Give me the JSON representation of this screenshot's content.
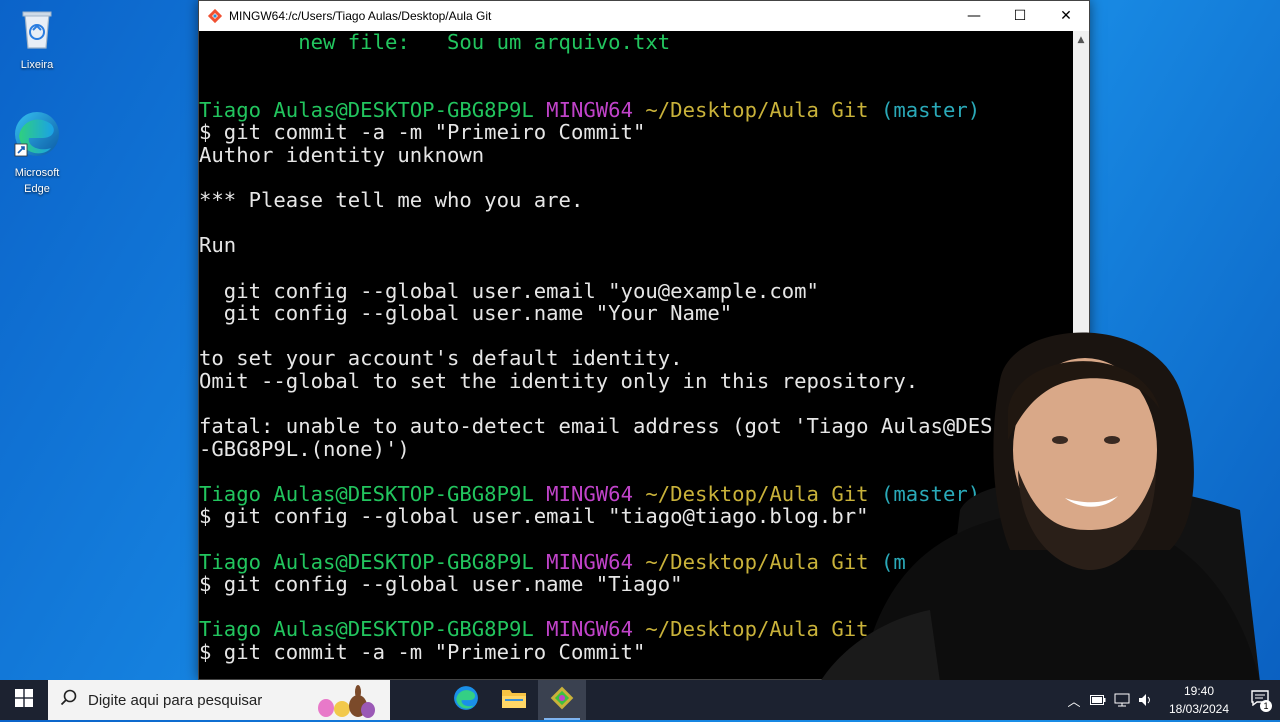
{
  "desktop": {
    "icons": [
      {
        "label": "Lixeira",
        "icon": "recycle-bin-icon"
      },
      {
        "label": "Microsoft\nEdge",
        "icon": "edge-icon"
      }
    ]
  },
  "window": {
    "title": "MINGW64:/c/Users/Tiago Aulas/Desktop/Aula Git",
    "controls": {
      "minimize": "—",
      "maximize": "☐",
      "close": "✕"
    }
  },
  "terminal": {
    "lines": [
      [
        {
          "t": "        new file:   Sou um arquivo.txt",
          "c": "green"
        }
      ],
      [],
      [],
      [
        {
          "t": "Tiago Aulas@DESKTOP-GBG8P9L ",
          "c": "green"
        },
        {
          "t": "MINGW64 ",
          "c": "mag"
        },
        {
          "t": "~/Desktop/Aula Git ",
          "c": "yel"
        },
        {
          "t": "(master)",
          "c": "cyan"
        }
      ],
      [
        {
          "t": "$ git commit -a -m \"Primeiro Commit\"",
          "c": ""
        }
      ],
      [
        {
          "t": "Author identity unknown",
          "c": ""
        }
      ],
      [],
      [
        {
          "t": "*** Please tell me who you are.",
          "c": ""
        }
      ],
      [],
      [
        {
          "t": "Run",
          "c": ""
        }
      ],
      [],
      [
        {
          "t": "  git config --global user.email \"you@example.com\"",
          "c": ""
        }
      ],
      [
        {
          "t": "  git config --global user.name \"Your Name\"",
          "c": ""
        }
      ],
      [],
      [
        {
          "t": "to set your account's default identity.",
          "c": ""
        }
      ],
      [
        {
          "t": "Omit --global to set the identity only in this repository.",
          "c": ""
        }
      ],
      [],
      [
        {
          "t": "fatal: unable to auto-detect email address (got 'Tiago Aulas@DES",
          "c": ""
        }
      ],
      [
        {
          "t": "-GBG8P9L.(none)')",
          "c": ""
        }
      ],
      [],
      [
        {
          "t": "Tiago Aulas@DESKTOP-GBG8P9L ",
          "c": "green"
        },
        {
          "t": "MINGW64 ",
          "c": "mag"
        },
        {
          "t": "~/Desktop/Aula Git ",
          "c": "yel"
        },
        {
          "t": "(master)",
          "c": "cyan"
        }
      ],
      [
        {
          "t": "$ git config --global user.email \"tiago@tiago.blog.br\"",
          "c": ""
        }
      ],
      [],
      [
        {
          "t": "Tiago Aulas@DESKTOP-GBG8P9L ",
          "c": "green"
        },
        {
          "t": "MINGW64 ",
          "c": "mag"
        },
        {
          "t": "~/Desktop/Aula Git ",
          "c": "yel"
        },
        {
          "t": "(m",
          "c": "cyan"
        }
      ],
      [
        {
          "t": "$ git config --global user.name \"Tiago\"",
          "c": ""
        }
      ],
      [],
      [
        {
          "t": "Tiago Aulas@DESKTOP-GBG8P9L ",
          "c": "green"
        },
        {
          "t": "MINGW64 ",
          "c": "mag"
        },
        {
          "t": "~/Desktop/Aula Git",
          "c": "yel"
        }
      ],
      [
        {
          "t": "$ git commit -a -m \"Primeiro Commit\"",
          "c": ""
        }
      ]
    ]
  },
  "taskbar": {
    "search_placeholder": "Digite aqui para pesquisar",
    "apps": [
      "edge-icon",
      "file-explorer-icon",
      "git-bash-icon"
    ],
    "clock_time": "19:40",
    "clock_date": "18/03/2024",
    "notification_count": "1"
  },
  "colors": {
    "terminal_bg": "#000000",
    "prompt_user": "#22c55e",
    "prompt_mingw": "#c043c9",
    "prompt_path": "#c9b23a",
    "prompt_branch": "#2aa9b8",
    "taskbar_bg": "#1c2230"
  }
}
